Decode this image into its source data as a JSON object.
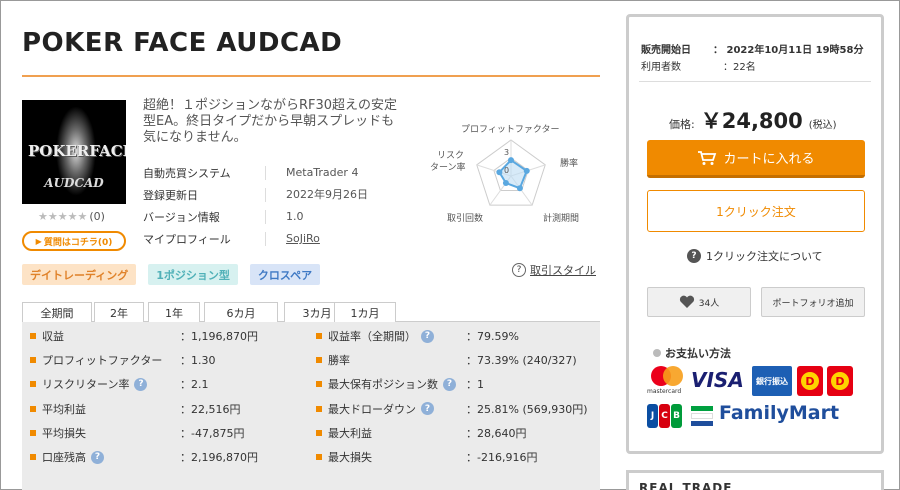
{
  "product": {
    "title": "POKER FACE AUDCAD",
    "thumb_text_left": "POKER",
    "thumb_text_right": "FACE",
    "thumb_text_bottom": "AUDCAD",
    "rating_stars": "★★★★★",
    "rating_count": "(0)",
    "question_button": "質問はコチラ(0)",
    "description": "超絶！１ポジションながらRF30超えの安定型EA。終日タイプだから早朝スプレッドも気になりません。"
  },
  "info": [
    {
      "label": "自動売買システム",
      "value": "MetaTrader 4"
    },
    {
      "label": "登録更新日",
      "value": "2022年9月26日"
    },
    {
      "label": "バージョン情報",
      "value": "1.0"
    },
    {
      "label": "マイプロフィール",
      "value": "SoJiRo"
    }
  ],
  "radar": {
    "labels": {
      "top": "プロフィットファクター",
      "right": "勝率",
      "bottom_right": "計測期間",
      "bottom_left": "取引回数",
      "left_line1": "リスク",
      "left_line2": "ターン率"
    },
    "scale_outer": "3",
    "scale_inner": "0",
    "values": [
      2.2,
      2.3,
      2.1,
      1.2,
      1.7
    ],
    "max": 5,
    "line_color": "#5aa8e0",
    "fill_color": "#bcdcf4"
  },
  "tags": [
    {
      "label": "デイトレーディング",
      "style": "orange"
    },
    {
      "label": "1ポジション型",
      "style": "teal"
    },
    {
      "label": "クロスペア",
      "style": "blue"
    }
  ],
  "trading_style_link": "取引スタイル",
  "tabs": [
    "全期間",
    "2年",
    "1年",
    "6カ月",
    "3カ月",
    "1カ月"
  ],
  "active_tab": "全期間",
  "stats": [
    [
      {
        "label": "収益",
        "value": "：1,196,870円",
        "help": false
      },
      {
        "label": "収益率（全期間）",
        "value": "：79.59%",
        "help": true
      }
    ],
    [
      {
        "label": "プロフィットファクター",
        "value": "：1.30",
        "help": false
      },
      {
        "label": "勝率",
        "value": "：73.39% (240/327)",
        "help": false
      }
    ],
    [
      {
        "label": "リスクリターン率",
        "value": "：2.1",
        "help": true
      },
      {
        "label": "最大保有ポジション数",
        "value": "：1",
        "help": true
      }
    ],
    [
      {
        "label": "平均利益",
        "value": "：22,516円",
        "help": false
      },
      {
        "label": "最大ドローダウン",
        "value": "：25.81% (569,930円)",
        "help": true
      }
    ],
    [
      {
        "label": "平均損失",
        "value": "：-47,875円",
        "help": false
      },
      {
        "label": "最大利益",
        "value": "：28,640円",
        "help": false
      }
    ],
    [
      {
        "label": "口座残高",
        "value": "：2,196,870円",
        "help": true
      },
      {
        "label": "最大損失",
        "value": "：-216,916円",
        "help": false
      }
    ]
  ],
  "sidebar": {
    "sale_start_label": "販売開始日",
    "sale_start_value": "：  2022年10月11日 19時58分",
    "users_label": "利用者数",
    "users_value": "：22名",
    "price_label": "価格:",
    "price_value": "￥24,800",
    "price_tax": "(税込)",
    "cart_button": "カートに入れる",
    "oneclick_button": "1クリック注文",
    "about_oneclick": "1クリック注文について",
    "favorite_count": "34人",
    "portfolio_button": "ポートフォリオ追加",
    "payment_title": "お支払い方法",
    "mastercard_text": "mastercard",
    "visa_text": "VISA",
    "bank_text": "銀行振込",
    "familymart_text": "FamilyMart",
    "real_trade": "REAL TRADE"
  },
  "colors": {
    "accent": "#f08a00",
    "rule": "#f0a050"
  }
}
